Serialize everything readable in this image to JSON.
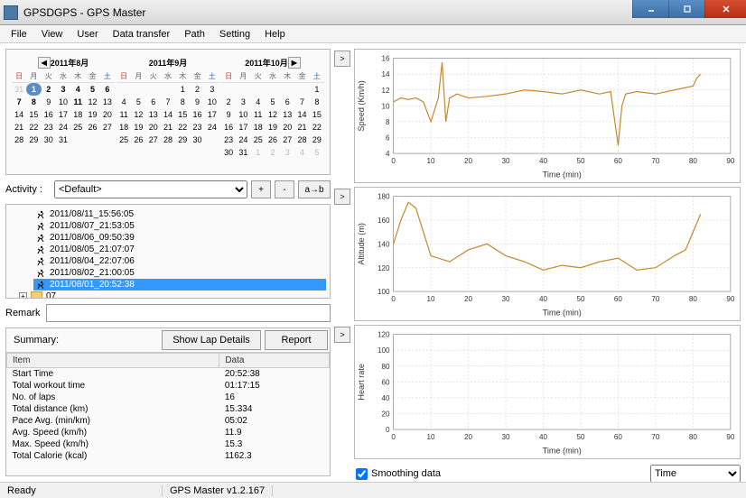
{
  "window": {
    "title": "GPSDGPS - GPS Master"
  },
  "menu": [
    "File",
    "View",
    "User",
    "Data transfer",
    "Path",
    "Setting",
    "Help"
  ],
  "calendars": [
    {
      "title": "2011年8月",
      "prev": true,
      "start_offset": 1,
      "days": 31,
      "prev_days": [
        31
      ],
      "bolds": [
        1,
        2,
        3,
        4,
        5,
        6,
        7,
        8,
        11
      ],
      "today": 1
    },
    {
      "title": "2011年9月",
      "start_offset": 4,
      "days": 30,
      "prev_days": [],
      "bolds": []
    },
    {
      "title": "2011年10月",
      "next": true,
      "start_offset": 6,
      "days": 31,
      "prev_days": [],
      "next_days": [
        1,
        2,
        3,
        4,
        5
      ],
      "bolds": []
    }
  ],
  "dow": [
    "日",
    "月",
    "火",
    "水",
    "木",
    "金",
    "土"
  ],
  "activity": {
    "label": "Activity :",
    "selected": "<Default>",
    "btns": [
      "+",
      "-",
      "a→b"
    ]
  },
  "tree": {
    "items": [
      "2011/08/11_15:56:05",
      "2011/08/07_21:53:05",
      "2011/08/06_09:50:39",
      "2011/08/05_21:07:07",
      "2011/08/04_22:07:06",
      "2011/08/02_21:00:05",
      "2011/08/01_20:52:38"
    ],
    "selected": 6,
    "folder": "07"
  },
  "remark": {
    "label": "Remark",
    "value": ""
  },
  "summary": {
    "label": "Summary:",
    "btn_lap": "Show Lap Details",
    "btn_report": "Report",
    "cols": [
      "Item",
      "Data"
    ],
    "rows": [
      [
        "Start Time",
        "20:52:38"
      ],
      [
        "Total workout time",
        "01:17:15"
      ],
      [
        "No. of laps",
        "16"
      ],
      [
        "Total distance (km)",
        "15.334"
      ],
      [
        "Pace Avg. (min/km)",
        "05:02"
      ],
      [
        "Avg. Speed (km/h)",
        "11.9"
      ],
      [
        "Max. Speed (km/h)",
        "15.3"
      ],
      [
        "Total Calorie (kcal)",
        "1162.3"
      ]
    ]
  },
  "charts": {
    "xlabel": "Time (min)",
    "xaxis_select": "Time",
    "smoothing_label": "Smoothing data",
    "smoothing": true,
    "speed": {
      "ylabel": "Speed (Km/h)",
      "yticks": [
        4,
        6,
        8,
        10,
        12,
        14,
        16
      ]
    },
    "altitude": {
      "ylabel": "Altitude (m)",
      "yticks": [
        100,
        120,
        140,
        160,
        180
      ]
    },
    "heartrate": {
      "ylabel": "Heart rate",
      "yticks": [
        0,
        20,
        40,
        60,
        80,
        100,
        120
      ]
    },
    "xticks": [
      0,
      10,
      20,
      30,
      40,
      50,
      60,
      70,
      80,
      90
    ]
  },
  "chart_data": [
    {
      "type": "line",
      "title": "",
      "ylabel": "Speed (Km/h)",
      "xlabel": "Time (min)",
      "xlim": [
        0,
        90
      ],
      "ylim": [
        4,
        16
      ],
      "x": [
        0,
        2,
        4,
        6,
        8,
        10,
        12,
        13,
        14,
        15,
        17,
        20,
        25,
        30,
        35,
        40,
        45,
        50,
        55,
        58,
        60,
        61,
        62,
        65,
        70,
        75,
        80,
        81,
        82
      ],
      "values": [
        10.5,
        11,
        10.8,
        11,
        10.5,
        8,
        11,
        15.5,
        8,
        11,
        11.5,
        11,
        11.2,
        11.5,
        12,
        11.8,
        11.5,
        12,
        11.5,
        11.8,
        5,
        10,
        11.5,
        11.8,
        11.5,
        12,
        12.5,
        13.5,
        14
      ]
    },
    {
      "type": "line",
      "ylabel": "Altitude (m)",
      "xlabel": "Time (min)",
      "xlim": [
        0,
        90
      ],
      "ylim": [
        100,
        180
      ],
      "x": [
        0,
        2,
        4,
        6,
        8,
        10,
        15,
        20,
        25,
        30,
        35,
        40,
        45,
        50,
        55,
        60,
        65,
        70,
        75,
        78,
        80,
        82
      ],
      "values": [
        140,
        160,
        175,
        170,
        150,
        130,
        125,
        135,
        140,
        130,
        125,
        118,
        122,
        120,
        125,
        128,
        118,
        120,
        130,
        135,
        150,
        165
      ]
    },
    {
      "type": "line",
      "ylabel": "Heart rate",
      "xlabel": "Time (min)",
      "xlim": [
        0,
        90
      ],
      "ylim": [
        0,
        120
      ],
      "x": [],
      "values": []
    }
  ],
  "status": {
    "ready": "Ready",
    "version": "GPS Master v1.2.167"
  }
}
